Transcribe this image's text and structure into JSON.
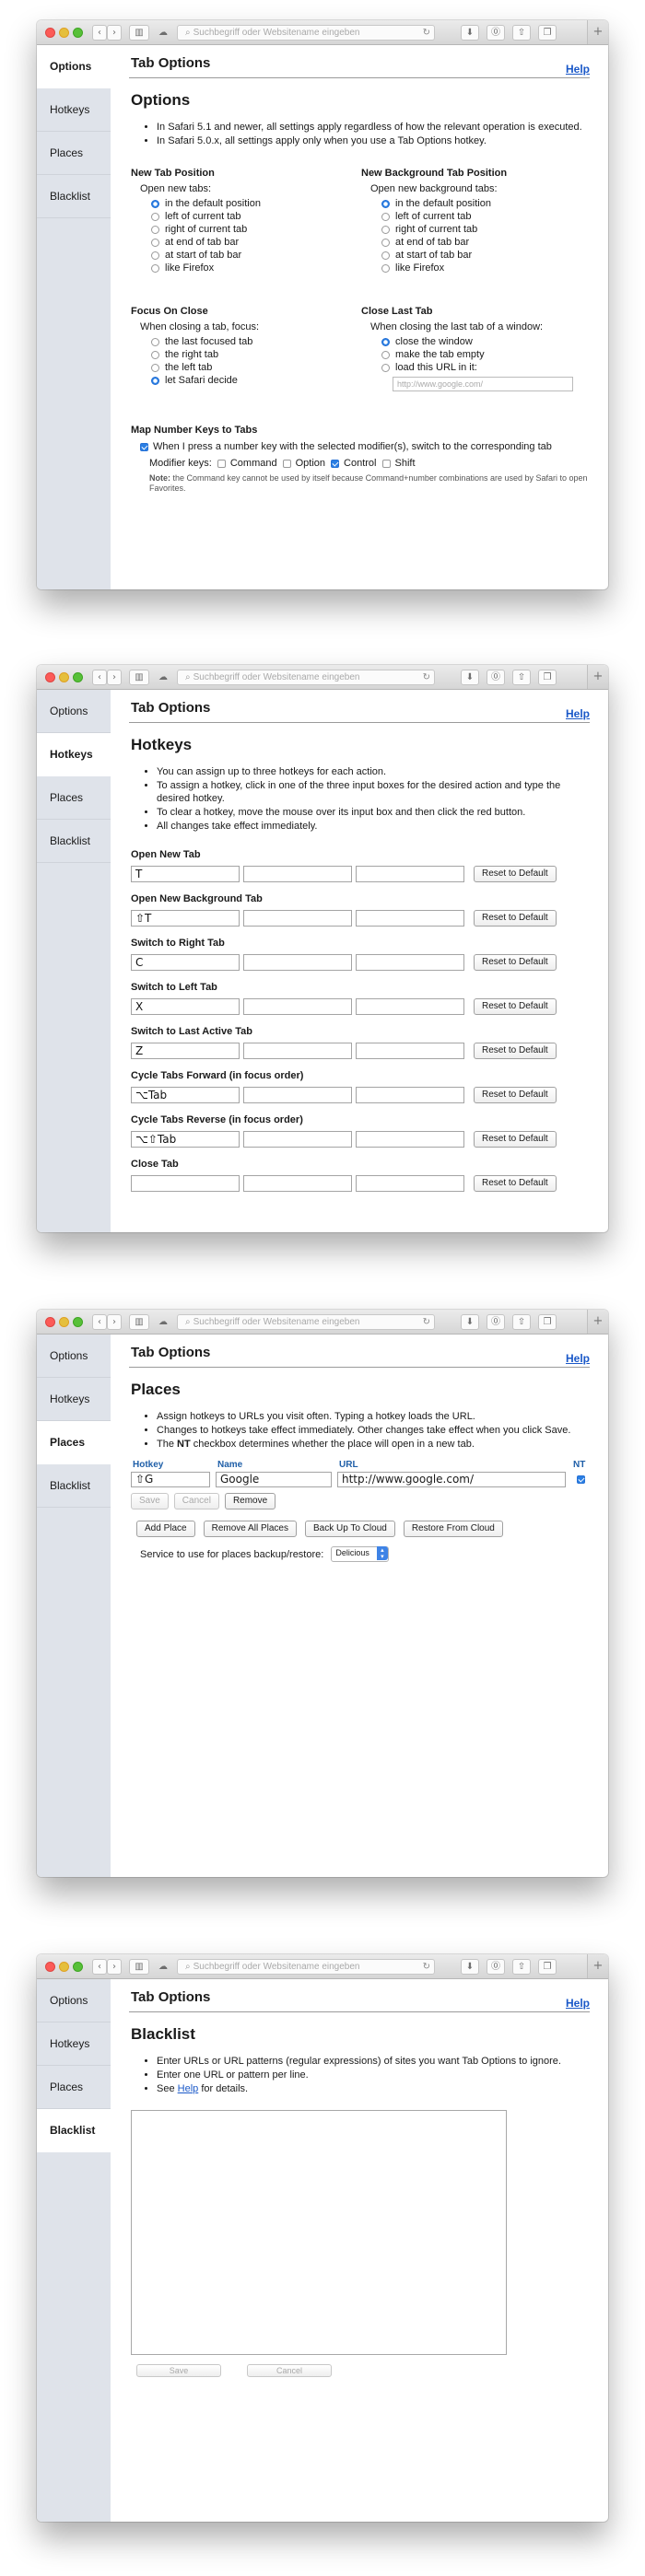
{
  "browser": {
    "search_placeholder": "Suchbegriff oder Websitename eingeben"
  },
  "nav": {
    "options": "Options",
    "hotkeys": "Hotkeys",
    "places": "Places",
    "blacklist": "Blacklist"
  },
  "header": {
    "title": "Tab Options",
    "help": "Help"
  },
  "options": {
    "heading": "Options",
    "notes": [
      "In Safari 5.1 and newer, all settings apply regardless of how the relevant operation is executed.",
      "In Safari 5.0.x, all settings apply only when you use a Tab Options hotkey."
    ],
    "new_tab_position": {
      "title": "New Tab Position",
      "subtitle": "Open new tabs:",
      "items": [
        "in the default position",
        "left of current tab",
        "right of current tab",
        "at end of tab bar",
        "at start of tab bar",
        "like Firefox"
      ],
      "selected": 0
    },
    "new_bg_tab_position": {
      "title": "New Background Tab Position",
      "subtitle": "Open new background tabs:",
      "items": [
        "in the default position",
        "left of current tab",
        "right of current tab",
        "at end of tab bar",
        "at start of tab bar",
        "like Firefox"
      ],
      "selected": 0
    },
    "focus_on_close": {
      "title": "Focus On Close",
      "subtitle": "When closing a tab, focus:",
      "items": [
        "the last focused tab",
        "the right tab",
        "the left tab",
        "let Safari decide"
      ],
      "selected": 3
    },
    "close_last_tab": {
      "title": "Close Last Tab",
      "subtitle": "When closing the last tab of a window:",
      "items": [
        "close the window",
        "make the tab empty",
        "load this URL in it:"
      ],
      "selected": 0,
      "url_placeholder": "http://www.google.com/"
    },
    "map_number_keys": {
      "title": "Map Number Keys to Tabs",
      "checkbox_label": "When I press a number key with the selected modifier(s), switch to the corresponding tab",
      "checked": true,
      "modifier_label": "Modifier keys:",
      "modifiers": [
        {
          "label": "Command",
          "checked": false
        },
        {
          "label": "Option",
          "checked": false
        },
        {
          "label": "Control",
          "checked": true
        },
        {
          "label": "Shift",
          "checked": false
        }
      ],
      "note_label": "Note:",
      "note": "the Command key cannot be used by itself because Command+number combinations are used by Safari to open Favorites."
    }
  },
  "hotkeys": {
    "heading": "Hotkeys",
    "notes": [
      "You can assign up to three hotkeys for each action.",
      "To assign a hotkey, click in one of the three input boxes for the desired action and type the desired hotkey.",
      "To clear a hotkey, move the mouse over its input box and then click the red button.",
      "All changes take effect immediately."
    ],
    "reset_label": "Reset to Default",
    "actions": [
      {
        "label": "Open New Tab",
        "keys": [
          "T",
          "",
          ""
        ]
      },
      {
        "label": "Open New Background Tab",
        "keys": [
          "⇧T",
          "",
          ""
        ]
      },
      {
        "label": "Switch to Right Tab",
        "keys": [
          "C",
          "",
          ""
        ]
      },
      {
        "label": "Switch to Left Tab",
        "keys": [
          "X",
          "",
          ""
        ]
      },
      {
        "label": "Switch to Last Active Tab",
        "keys": [
          "Z",
          "",
          ""
        ]
      },
      {
        "label": "Cycle Tabs Forward (in focus order)",
        "keys": [
          "⌥Tab",
          "",
          ""
        ]
      },
      {
        "label": "Cycle Tabs Reverse (in focus order)",
        "keys": [
          "⌥⇧Tab",
          "",
          ""
        ]
      },
      {
        "label": "Close Tab",
        "keys": [
          "",
          "",
          ""
        ]
      }
    ]
  },
  "places": {
    "heading": "Places",
    "notes_plain": [
      "Assign hotkeys to URLs you visit often. Typing a hotkey loads the URL.",
      "Changes to hotkeys take effect immediately. Other changes take effect when you click Save."
    ],
    "note3_prefix": "The",
    "note3_bold": "NT",
    "note3_suffix": "checkbox determines whether the place will open in a new tab.",
    "columns": {
      "hotkey": "Hotkey",
      "name": "Name",
      "url": "URL",
      "nt": "NT"
    },
    "rows": [
      {
        "hotkey": "⇧G",
        "name": "Google",
        "url": "http://www.google.com/",
        "nt": true
      }
    ],
    "row_save": "Save",
    "row_cancel": "Cancel",
    "row_remove": "Remove",
    "add_place": "Add Place",
    "remove_all": "Remove All Places",
    "backup": "Back Up To Cloud",
    "restore": "Restore From Cloud",
    "service_label": "Service to use for places backup/restore:",
    "service_value": "Delicious"
  },
  "blacklist": {
    "heading": "Blacklist",
    "note1": "Enter URLs or URL patterns (regular expressions) of sites you want Tab Options to ignore.",
    "note2": "Enter one URL or pattern per line.",
    "note3_prefix": "See",
    "note3_link": "Help",
    "note3_suffix": "for details.",
    "save": "Save",
    "cancel": "Cancel"
  }
}
